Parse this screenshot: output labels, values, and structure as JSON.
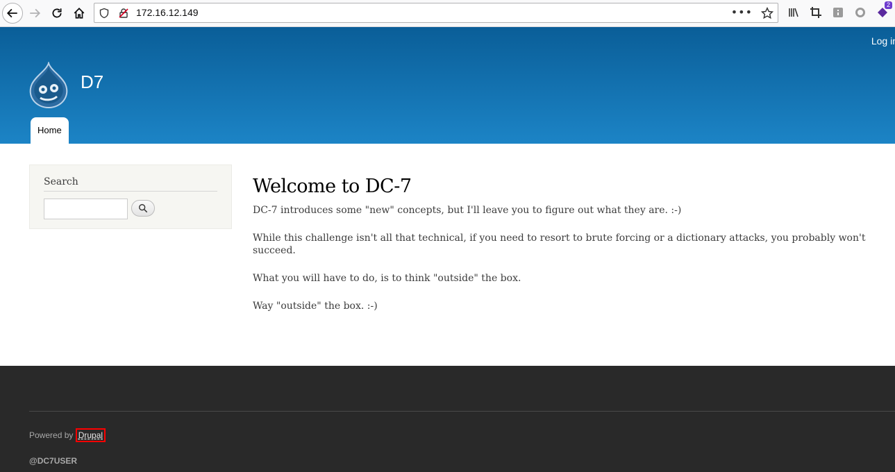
{
  "browser": {
    "url": "172.16.12.149",
    "page_actions": "•••",
    "extensions_badge": "2"
  },
  "header": {
    "login_label": "Log in",
    "site_name": "D7",
    "menu": [
      {
        "label": "Home"
      }
    ]
  },
  "sidebar": {
    "search_title": "Search",
    "search_value": ""
  },
  "content": {
    "title": "Welcome to DC-7",
    "paragraphs": [
      "DC-7 introduces some \"new\" concepts, but I'll leave you to figure out what they are.  :-)",
      "While this challenge isn't all that technical, if you need to resort to brute forcing or a dictionary attacks, you probably won't succeed.",
      "What you will have to do, is to think \"outside\" the box.",
      "Way \"outside\" the box.  :-)"
    ]
  },
  "footer": {
    "powered_by": "Powered by",
    "drupal_link": "Drupal",
    "user_handle": "@DC7USER"
  },
  "colors": {
    "header_top": "#0a5e98",
    "header_bottom": "#1c84c6",
    "footer_bg": "#292929",
    "highlight": "#ff0000"
  }
}
